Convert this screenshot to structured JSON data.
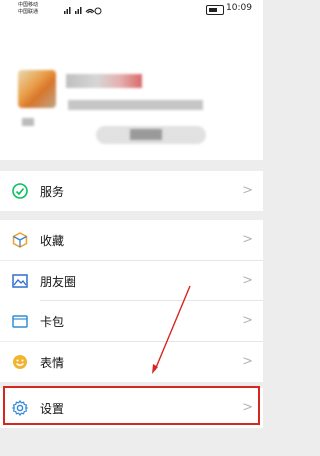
{
  "status_bar": {
    "carrier_1": "中国移动",
    "carrier_2": "中国联通",
    "time": "10:09"
  },
  "menu": {
    "items": [
      {
        "label": "服务",
        "icon": "service-icon"
      },
      {
        "label": "收藏",
        "icon": "favorites-icon"
      },
      {
        "label": "朋友圈",
        "icon": "moments-icon"
      },
      {
        "label": "卡包",
        "icon": "card-wallet-icon"
      },
      {
        "label": "表情",
        "icon": "emoji-icon"
      },
      {
        "label": "设置",
        "icon": "settings-icon"
      }
    ],
    "chevron": ">"
  },
  "annotation": {
    "highlight_color": "#d7261f"
  },
  "colors": {
    "service_green": "#07c160",
    "favorites_orange": "#f0a030",
    "moments_blue": "#2f6fd1",
    "card_blue": "#2f8fd1",
    "emoji_yellow": "#f2b531",
    "settings_blue": "#2f86d6"
  }
}
